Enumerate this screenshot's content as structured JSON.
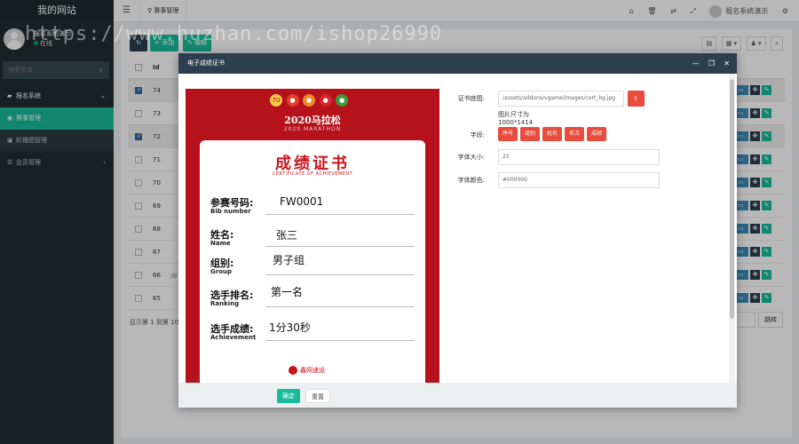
{
  "app": {
    "title": "我的网站",
    "watermark": "https://www.huzhan.com/ishop26990"
  },
  "user": {
    "name": "报名系统演示",
    "status": "在线"
  },
  "sidebar": {
    "search_placeholder": "搜索菜单",
    "items": [
      {
        "label": "报名系统",
        "icon": "folder-icon",
        "arrow": "⌄"
      },
      {
        "label": "赛事管理",
        "icon": "circle-icon",
        "active": true
      },
      {
        "label": "轮播图管理",
        "icon": "image-icon"
      },
      {
        "label": "会员管理",
        "icon": "list-icon",
        "arrow": "‹"
      }
    ]
  },
  "header": {
    "tab": "赛事管理",
    "user_label": "报名系统演示"
  },
  "toolbar": {
    "refresh": "↻",
    "add": "+ 添加",
    "edit": "✎ 编辑"
  },
  "table": {
    "header_id": "Id",
    "rows": [
      {
        "id": "74",
        "checked": true
      },
      {
        "id": "73",
        "checked": false
      },
      {
        "id": "72",
        "checked": true
      },
      {
        "id": "71",
        "checked": false
      },
      {
        "id": "70",
        "checked": false
      },
      {
        "id": "69",
        "checked": false
      },
      {
        "id": "68",
        "checked": false
      },
      {
        "id": "67",
        "checked": false
      },
      {
        "id": "66",
        "name": "尚",
        "checked": false
      },
      {
        "id": "65",
        "checked": false
      }
    ],
    "footer": "显示第 1 到第 10",
    "goto": "跳转"
  },
  "modal": {
    "title": "电子成绩证书",
    "cert": {
      "heading": "2020马拉松",
      "heading_en": "2020 MARATHON",
      "card_title": "成绩证书",
      "card_title_en": "CERTIFICATE OF ACHIEVEMENT",
      "fields": [
        {
          "label": "参赛号码:",
          "en": "Bib number",
          "value": "FW0001"
        },
        {
          "label": "姓名:",
          "en": "Name",
          "value": "张三"
        },
        {
          "label": "组别:",
          "en": "Group",
          "value": "男子组"
        },
        {
          "label": "选手排名:",
          "en": "Ranking",
          "value": "第一名"
        },
        {
          "label": "选手成绩:",
          "en": "Achievement",
          "value": "1分30秒"
        }
      ],
      "stamp": "鑫网速运"
    },
    "form": {
      "image_label": "证书底图:",
      "image_value": "/assets/addons/vgame/images/cert_bg.jpg",
      "upload": "上传",
      "size_hint": "图片尺寸为1000*1414",
      "field_label": "字段:",
      "tags": [
        "序号",
        "组别",
        "姓名",
        "名次",
        "成绩"
      ],
      "font_size_label": "字体大小:",
      "font_size_value": "25",
      "font_color_label": "字体颜色:",
      "font_color_value": "#000000"
    },
    "buttons": {
      "ok": "确定",
      "reset": "重置"
    }
  }
}
